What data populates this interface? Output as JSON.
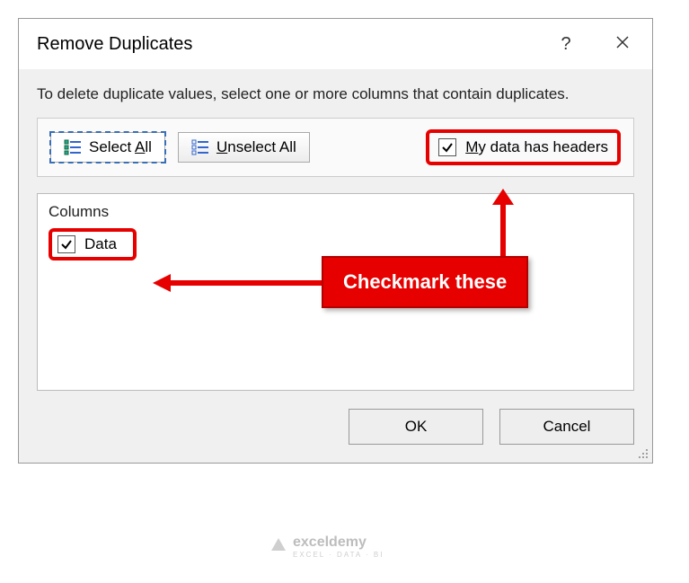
{
  "titlebar": {
    "title": "Remove Duplicates"
  },
  "body": {
    "instruction": "To delete duplicate values, select one or more columns that contain duplicates."
  },
  "toolbar": {
    "select_all_prefix": "Select ",
    "select_all_accel": "A",
    "select_all_suffix": "ll",
    "unselect_all_accel": "U",
    "unselect_all_suffix": "nselect All",
    "headers_accel": "M",
    "headers_suffix": "y data has headers"
  },
  "columns": {
    "header": "Columns",
    "items": [
      {
        "label": "Data",
        "checked": true
      }
    ]
  },
  "footer": {
    "ok": "OK",
    "cancel": "Cancel"
  },
  "annotation": {
    "callout": "Checkmark these"
  },
  "watermark": {
    "brand": "exceldemy",
    "tagline": "EXCEL · DATA · BI"
  }
}
